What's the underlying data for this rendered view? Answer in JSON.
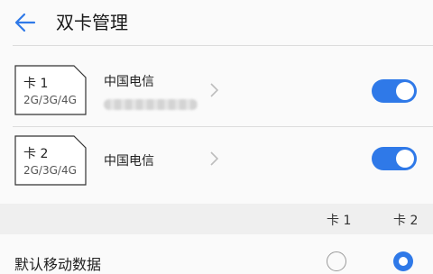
{
  "header": {
    "title": "双卡管理",
    "back_icon": "arrow-left-icon"
  },
  "sims": [
    {
      "name": "卡 1",
      "network": "2G/3G/4G",
      "carrier": "中国电信",
      "number_obscured": true,
      "enabled": true
    },
    {
      "name": "卡 2",
      "network": "2G/3G/4G",
      "carrier": "中国电信",
      "number_obscured": false,
      "enabled": true
    }
  ],
  "columns": {
    "sim1": "卡 1",
    "sim2": "卡 2"
  },
  "default_data": {
    "label": "默认移动数据",
    "selected": "sim2"
  },
  "colors": {
    "accent": "#2f79e8",
    "section_bg": "#efefef",
    "page_bg": "#fafafa"
  }
}
